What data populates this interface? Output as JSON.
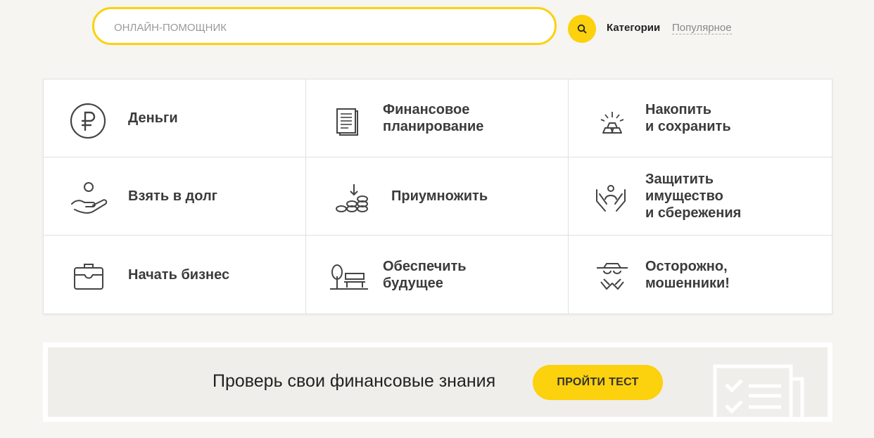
{
  "search": {
    "placeholder": "Онлайн-помощник"
  },
  "nav": {
    "categories": "Категории",
    "popular": "Популярное"
  },
  "categories": [
    {
      "label": "Деньги",
      "icon": "ruble-icon"
    },
    {
      "label": "Финансовое\nпланирование",
      "icon": "document-icon"
    },
    {
      "label": "Накопить\nи сохранить",
      "icon": "gold-bars-icon"
    },
    {
      "label": "Взять в долг",
      "icon": "hand-coin-icon"
    },
    {
      "label": "Приумножить",
      "icon": "coins-stack-icon"
    },
    {
      "label": "Защитить\nимущество\nи сбережения",
      "icon": "protect-hands-icon"
    },
    {
      "label": "Начать бизнес",
      "icon": "briefcase-icon"
    },
    {
      "label": "Обеспечить\nбудущее",
      "icon": "bench-tree-icon"
    },
    {
      "label": "Осторожно,\nмошенники!",
      "icon": "fraudster-icon"
    }
  ],
  "banner": {
    "text": "Проверь свои финансовые знания",
    "button": "Пройти тест"
  },
  "colors": {
    "accent": "#fcd10d",
    "background": "#f6f5f2",
    "text": "#3b3b3b"
  }
}
